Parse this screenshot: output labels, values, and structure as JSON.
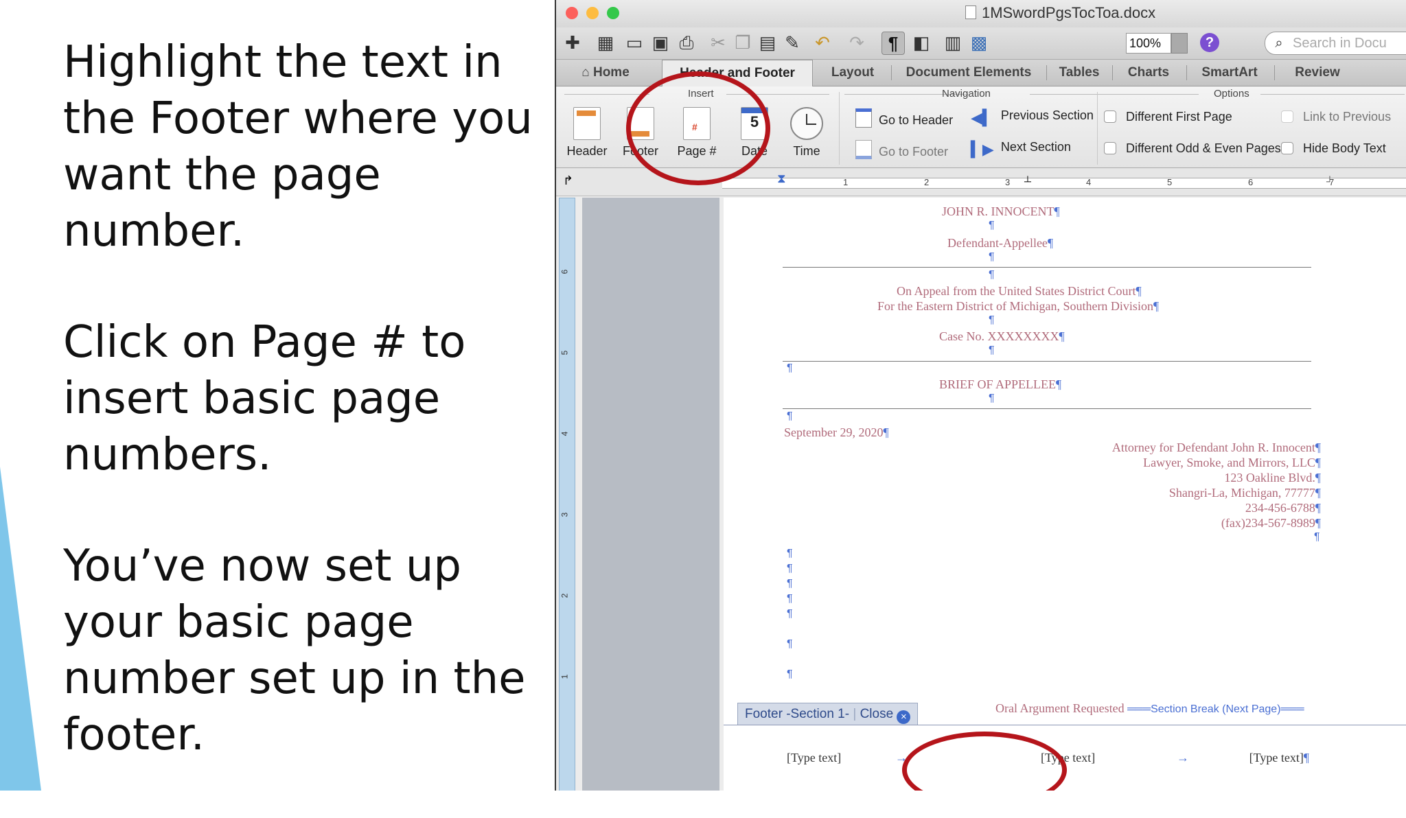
{
  "colors": {
    "accent": "#7fc6ea",
    "annotation": "#b5151b",
    "doc_text": "#b06a7a",
    "formatting_marks": "#4a6fd3"
  },
  "slide": {
    "paragraphs": [
      "Highlight the text in the Footer where you want the page number.",
      "Click on Page # to insert basic page numbers.",
      "You’ve now set up your basic page number set up in the footer."
    ]
  },
  "window": {
    "title": "1MSwordPgsTocToa.docx"
  },
  "toolbar": {
    "zoom": "100%",
    "search_placeholder": "Search in Docu",
    "pilcrow": "¶"
  },
  "tabs": [
    "Home",
    "Header and Footer",
    "Layout",
    "Document Elements",
    "Tables",
    "Charts",
    "SmartArt",
    "Review"
  ],
  "ribbon": {
    "insert_label": "Insert",
    "navigation_label": "Navigation",
    "options_label": "Options",
    "insert_buttons": [
      "Header",
      "Footer",
      "Page #",
      "Date",
      "Time"
    ],
    "date_icon_day": "5",
    "go_to_header": "Go to Header",
    "go_to_footer": "Go to Footer",
    "previous_section": "Previous Section",
    "next_section": "Next Section",
    "different_first_page": "Different First Page",
    "different_odd_even": "Different Odd & Even Pages",
    "link_to_previous": "Link to Previous",
    "hide_body_text": "Hide Body Text"
  },
  "ruler": {
    "numbers": [
      "1",
      "2",
      "3",
      "4",
      "5",
      "6",
      "7"
    ],
    "vertical_numbers": [
      "6",
      "5",
      "4",
      "3",
      "2",
      "1"
    ]
  },
  "document": {
    "name": "JOHN R. INNOCENT",
    "party": "Defendant-Appellee",
    "appeal_line1": "On Appeal from the United States District Court",
    "appeal_line2": "For the Eastern District of Michigan, Southern Division",
    "case_no": "Case No. XXXXXXXX",
    "brief_title": "BRIEF OF APPELLEE",
    "date": "September 29, 2020",
    "attorney_block": [
      "Attorney for Defendant John R. Innocent",
      "Lawyer, Smoke, and Mirrors, LLC",
      "123 Oakline Blvd.",
      "Shangri-La, Michigan, 77777",
      "234-456-6788",
      "(fax)234-567-8989"
    ],
    "pilcrow": "¶",
    "oral_argument": "Oral Argument Requested",
    "section_break": "Section Break (Next Page)"
  },
  "footer": {
    "tab_label": "Footer -Section 1-",
    "close_label": "Close",
    "close_icon": "×",
    "tab_arrow": "→",
    "left_text": "[Type text]",
    "center_text": "[Type text]",
    "right_text": "[Type text]"
  }
}
